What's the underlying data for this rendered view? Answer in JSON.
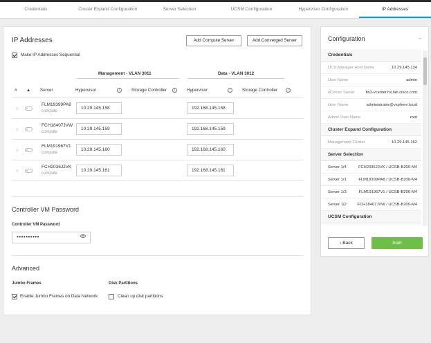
{
  "tabs": [
    {
      "label": "Credentials"
    },
    {
      "label": "Cluster Expand Configuration"
    },
    {
      "label": "Server Selection"
    },
    {
      "label": "UCSM Configuration"
    },
    {
      "label": "Hypervisor Configuration"
    },
    {
      "label": "IP Addresses"
    }
  ],
  "main": {
    "title": "IP Addresses",
    "add_compute_label": "Add Compute Server",
    "add_converged_label": "Add Converged Server",
    "sequential_label": "Make IP Addresses Sequential",
    "groups": {
      "management": "Management - VLAN 3011",
      "data": "Data - VLAN 3012"
    },
    "columns": {
      "number": "#",
      "server": "Server",
      "hypervisor": "Hypervisor",
      "storage_controller": "Storage Controller",
      "data_hypervisor": "Hypervisor",
      "data_storage_controller": "Storage Controller"
    },
    "rows": [
      {
        "server": "FLM19399PA8",
        "type": "compute",
        "mgmt_hypervisor": "10.29.145.158",
        "data_hypervisor": "192.168.145.158"
      },
      {
        "server": "FCH18407JVW",
        "type": "compute",
        "mgmt_hypervisor": "10.29.145.159",
        "data_hypervisor": "192.168.145.159"
      },
      {
        "server": "FLM191967V1",
        "type": "compute",
        "mgmt_hypervisor": "10.29.145.160",
        "data_hypervisor": "192.168.145.160"
      },
      {
        "server": "FCH2036J2VK",
        "type": "compute",
        "mgmt_hypervisor": "10.29.145.161",
        "data_hypervisor": "192.168.145.161"
      }
    ],
    "controller_vm": {
      "section_title": "Controller VM Password",
      "field_label": "Controller VM Password",
      "value": "••••••••••"
    },
    "advanced": {
      "section_title": "Advanced",
      "jumbo_label": "Jumbo Frames",
      "jumbo_checkbox": "Enable Jumbo Frames on Data Network",
      "disk_label": "Disk Partitions",
      "disk_checkbox": "Clean up disk partitions"
    }
  },
  "side": {
    "title": "Configuration",
    "sections": {
      "credentials": "Credentials",
      "cluster_expand": "Cluster Expand Configuration",
      "server_selection": "Server Selection",
      "ucsm": "UCSM Configuration"
    },
    "credentials": [
      {
        "key": "UCS Manager Host Name",
        "value": "10.29.145.134"
      },
      {
        "key": "User Name",
        "value": "admin"
      },
      {
        "key": "vCenter Server",
        "value": "hx3-vcenter.hx.lab.cisco.com"
      },
      {
        "key": "User Name",
        "value": "administrator@vsphere.local"
      },
      {
        "key": "Admin User Name",
        "value": "root"
      }
    ],
    "cluster_expand": [
      {
        "key": "Management Cluster",
        "value": "10.29.145.162"
      }
    ],
    "servers": [
      {
        "key": "Server 1/4",
        "value": "FCH2036J2VK / UCSB-B200-M4"
      },
      {
        "key": "Server 1/1",
        "value": "FLM19399PA8 / UCSB-B200-M4"
      },
      {
        "key": "Server 1/3",
        "value": "FLM191967V1 / UCSB-B200-M4"
      },
      {
        "key": "Server 1/2",
        "value": "FCH18407JVW / UCSB-B200-M4"
      }
    ],
    "back_label": "Back",
    "start_label": "Start"
  }
}
